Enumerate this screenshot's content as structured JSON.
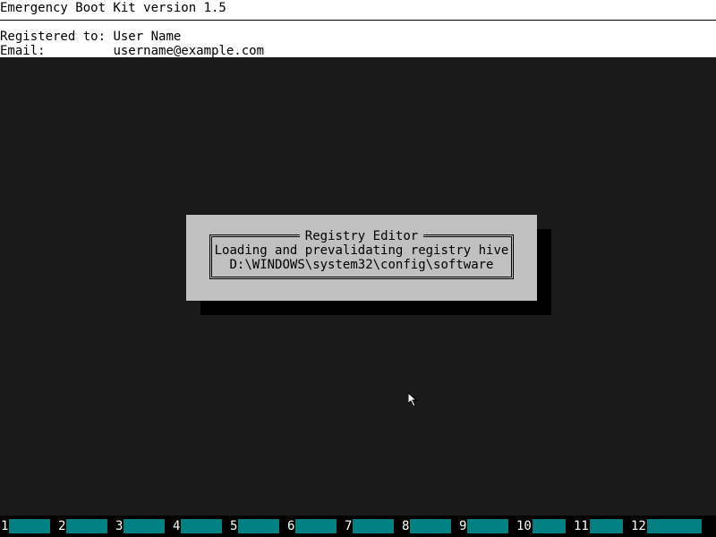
{
  "header": {
    "title": "Emergency Boot Kit version 1.5",
    "registered_label": "Registered to:",
    "registered_value": "User Name",
    "email_label": "Email:",
    "email_value": "username@example.com"
  },
  "dialog": {
    "title": "Registry Editor",
    "line1": "Loading and prevalidating registry hive",
    "line2": "D:\\WINDOWS\\system32\\config\\software"
  },
  "function_keys": [
    {
      "number": "1",
      "label": ""
    },
    {
      "number": "2",
      "label": ""
    },
    {
      "number": "3",
      "label": ""
    },
    {
      "number": "4",
      "label": ""
    },
    {
      "number": "5",
      "label": ""
    },
    {
      "number": "6",
      "label": ""
    },
    {
      "number": "7",
      "label": ""
    },
    {
      "number": "8",
      "label": ""
    },
    {
      "number": "9",
      "label": ""
    },
    {
      "number": "10",
      "label": ""
    },
    {
      "number": "11",
      "label": ""
    },
    {
      "number": "12",
      "label": ""
    }
  ],
  "colors": {
    "desktop": "#000000",
    "dialog_bg": "#c0c0c0",
    "fkey_bar": "#008080",
    "header_bg": "#ffffff"
  },
  "icons": {
    "cursor": "mouse-pointer-icon"
  }
}
